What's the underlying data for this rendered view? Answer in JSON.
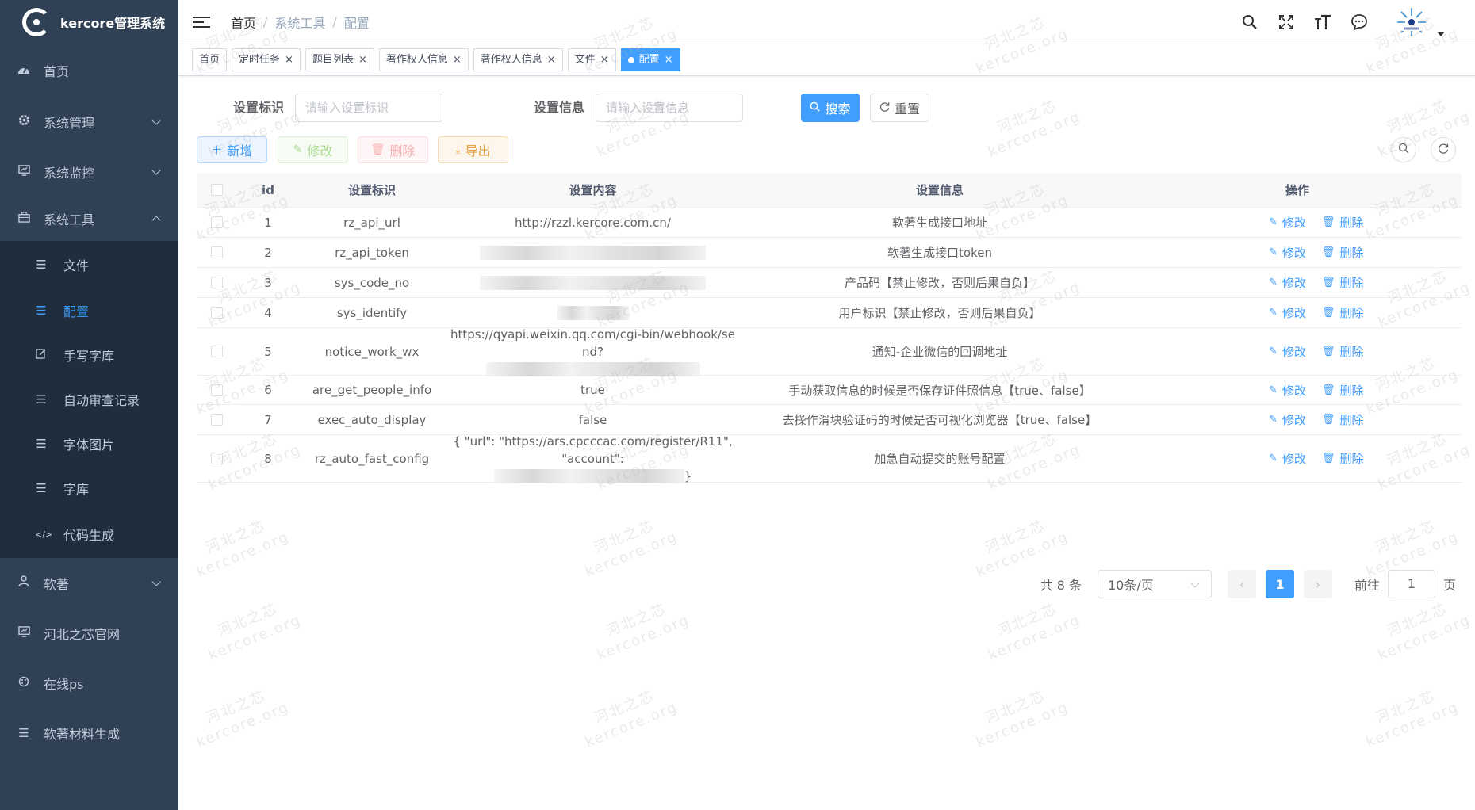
{
  "app": {
    "title": "kercore管理系统"
  },
  "sidebar": {
    "items": [
      {
        "label": "首页",
        "icon": "dashboard-icon"
      },
      {
        "label": "系统管理",
        "icon": "gear-icon"
      },
      {
        "label": "系统监控",
        "icon": "monitor-icon"
      },
      {
        "label": "系统工具",
        "icon": "toolbox-icon"
      },
      {
        "label": "软著",
        "icon": "user-icon"
      },
      {
        "label": "河北之芯官网",
        "icon": "monitor-icon"
      },
      {
        "label": "在线ps",
        "icon": "palette-icon"
      },
      {
        "label": "软著材料生成",
        "icon": "list-icon"
      }
    ],
    "tool_submenu": [
      {
        "label": "文件"
      },
      {
        "label": "配置"
      },
      {
        "label": "手写字库"
      },
      {
        "label": "自动审查记录"
      },
      {
        "label": "字体图片"
      },
      {
        "label": "字库"
      },
      {
        "label": "代码生成"
      }
    ]
  },
  "breadcrumb": {
    "home": "首页",
    "sep": "/",
    "level1": "系统工具",
    "level2": "配置"
  },
  "tags": [
    {
      "label": "首页"
    },
    {
      "label": "定时任务"
    },
    {
      "label": "题目列表"
    },
    {
      "label": "著作权人信息"
    },
    {
      "label": "著作权人信息"
    },
    {
      "label": "文件"
    },
    {
      "label": "配置"
    }
  ],
  "search": {
    "key_label": "设置标识",
    "key_placeholder": "请输入设置标识",
    "info_label": "设置信息",
    "info_placeholder": "请输入设置信息",
    "search_btn": "搜索",
    "reset_btn": "重置"
  },
  "toolbar": {
    "add": "新增",
    "edit": "修改",
    "delete": "删除",
    "export": "导出"
  },
  "table": {
    "headers": {
      "id": "id",
      "key": "设置标识",
      "value": "设置内容",
      "info": "设置信息",
      "op": "操作"
    },
    "edit_label": "修改",
    "delete_label": "删除",
    "rows": [
      {
        "id": "1",
        "key": "rz_api_url",
        "value": "http://rzzl.kercore.com.cn/",
        "info": "软著生成接口地址"
      },
      {
        "id": "2",
        "key": "rz_api_token",
        "value": "",
        "info": "软著生成接口token"
      },
      {
        "id": "3",
        "key": "sys_code_no",
        "value": "",
        "info": "产品码【禁止修改，否则后果自负】"
      },
      {
        "id": "4",
        "key": "sys_identify",
        "value": "",
        "info": "用户标识【禁止修改，否则后果自负】"
      },
      {
        "id": "5",
        "key": "notice_work_wx",
        "value": "https://qyapi.weixin.qq.com/cgi-bin/webhook/send?",
        "info": "通知-企业微信的回调地址"
      },
      {
        "id": "6",
        "key": "are_get_people_info",
        "value": "true",
        "info": "手动获取信息的时候是否保存证件照信息【true、false】"
      },
      {
        "id": "7",
        "key": "exec_auto_display",
        "value": "false",
        "info": "去操作滑块验证码的时候是否可视化浏览器【true、false】"
      },
      {
        "id": "8",
        "key": "rz_auto_fast_config",
        "value": "{ \"url\": \"https://ars.cpcccac.com/register/R11\", \"account\":",
        "value_tail": "}",
        "info": "加急自动提交的账号配置"
      }
    ]
  },
  "pager": {
    "total": "共 8 条",
    "page_size": "10条/页",
    "current": "1",
    "goto": "前往",
    "goto_value": "1",
    "page_unit": "页"
  },
  "watermark": {
    "line1": "河北之芯",
    "line2": "kercore.org"
  },
  "colors": {
    "sidebar_bg": "#304156",
    "submenu_bg": "#1f2d3d",
    "primary": "#409eff"
  }
}
